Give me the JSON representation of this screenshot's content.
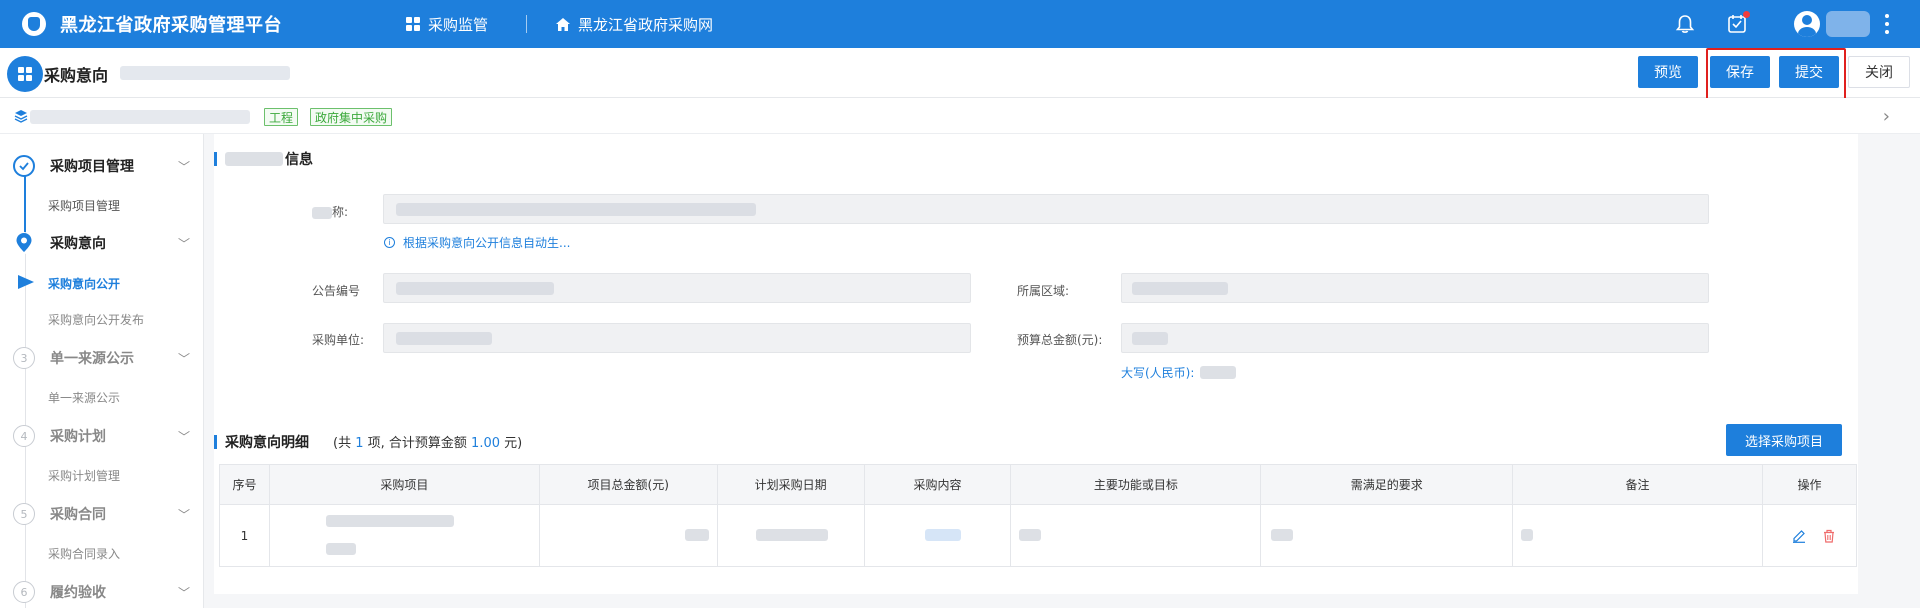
{
  "topbar": {
    "app_title": "黑龙江省政府采购管理平台",
    "nav": [
      {
        "label": "采购监管",
        "icon": "grid-icon"
      },
      {
        "label": "黑龙江省政府采购网",
        "icon": "home-icon"
      }
    ],
    "icons": [
      "bell-icon",
      "task-icon",
      "avatar",
      "more-icon"
    ]
  },
  "header": {
    "title": "采购意向",
    "buttons": {
      "preview": "预览",
      "save": "保存",
      "submit": "提交",
      "close": "关闭"
    }
  },
  "breadcrumb": {
    "tags": [
      "工程",
      "政府集中采购"
    ]
  },
  "sidebar": {
    "steps": [
      {
        "number": "",
        "label": "采购项目管理",
        "state": "done",
        "subs": [
          "采购项目管理"
        ]
      },
      {
        "number": "",
        "label": "采购意向",
        "state": "current",
        "subs": [
          "采购意向公开",
          "采购意向公开发布"
        ]
      },
      {
        "number": "3",
        "label": "单一来源公示",
        "state": "todo",
        "subs": [
          "单一来源公示"
        ]
      },
      {
        "number": "4",
        "label": "采购计划",
        "state": "todo",
        "subs": [
          "采购计划管理"
        ]
      },
      {
        "number": "5",
        "label": "采购合同",
        "state": "todo",
        "subs": [
          "采购合同录入"
        ]
      },
      {
        "number": "6",
        "label": "履约验收",
        "state": "todo",
        "subs": []
      }
    ]
  },
  "form": {
    "section_title_suffix": "信息",
    "name_label_suffix": "称:",
    "hint": "根据采购意向公开信息自动生...",
    "announcement_label": "公告编号",
    "region_label": "所属区域:",
    "unit_label": "采购单位:",
    "budget_label": "预算总金额(元):",
    "budget_caps_prefix": "大写(人民币):"
  },
  "details": {
    "title": "采购意向明细",
    "summary_prefix": "(共",
    "count": "1",
    "summary_mid": "项,  合计预算金额",
    "amount": "1.00",
    "summary_suffix": "元)",
    "select_button": "选择采购项目",
    "columns": [
      "序号",
      "采购项目",
      "项目总金额(元)",
      "计划采购日期",
      "采购内容",
      "主要功能或目标",
      "需满足的要求",
      "备注",
      "操作"
    ],
    "rows": [
      {
        "index": "1"
      }
    ]
  },
  "colors": {
    "primary": "#1e7fdc",
    "highlight": "#e0201e",
    "tag_green": "#3ba93b"
  }
}
